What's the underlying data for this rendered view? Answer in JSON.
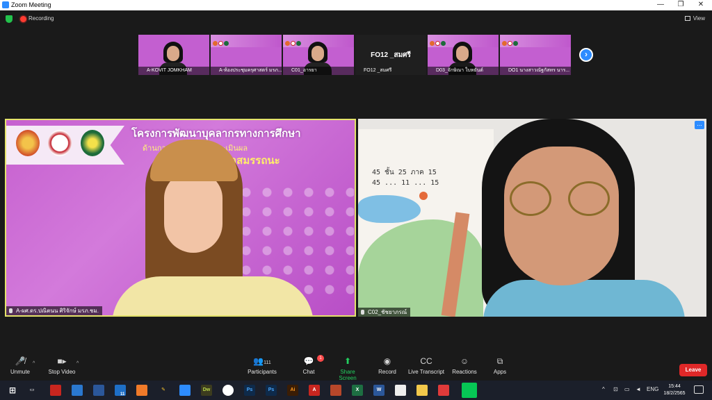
{
  "window": {
    "title": "Zoom Meeting",
    "minimize": "—",
    "restore": "❐",
    "close": "✕"
  },
  "status": {
    "recording_label": "Recording",
    "view_label": "View"
  },
  "thumbnails": [
    {
      "name": "A-KOVIT JOMKHAM",
      "kind": "video-man"
    },
    {
      "name": "A-ห้องประชุมครุศาสตร์ มรภ....",
      "kind": "slide"
    },
    {
      "name": "C01_อารยา",
      "kind": "video-woman"
    },
    {
      "name": "FO12 _สมศรี",
      "kind": "name-only",
      "big_label": "FO12 _สมศรี"
    },
    {
      "name": "D03_จักษิณา ใบหยันต์",
      "kind": "video-woman"
    },
    {
      "name": "DO1 นางสาวณัฐกัสทร  นาร...",
      "kind": "slide"
    }
  ],
  "main_left": {
    "name": "A-ผศ.ดร.ปณิตนน ศิริจักษ์ มรภ.ชม.",
    "slide_title": "โครงการพัฒนาบุคลากรทางการศึกษา",
    "slide_subtitle": "ด้านการ...และการวัดประเมินผล",
    "slide_subtitle2": "...นาสมรรถนะ"
  },
  "main_right": {
    "name": "C02_ชัชยาภรณ์",
    "paper_lines": [
      "45   ชั้น    25 ภาค 15",
      "45   ...    11  ...  15"
    ],
    "more_label": "..."
  },
  "toolbar": {
    "unmute": "Unmute",
    "stop_video": "Stop Video",
    "participants": "Participants",
    "participants_count": "111",
    "chat": "Chat",
    "chat_badge": "1",
    "share_screen": "Share Screen",
    "record": "Record",
    "live_transcript": "Live Transcript",
    "reactions": "Reactions",
    "apps": "Apps",
    "leave": "Leave"
  },
  "taskbar": {
    "language": "ENG",
    "time": "15:44",
    "date": "18/2/2565",
    "mail_badge": "11",
    "apps": [
      "Ps",
      "Ps",
      "Ai",
      "A",
      "X",
      "W",
      "Dw"
    ]
  },
  "colors": {
    "accent": "#2d8cff",
    "leave": "#e02828",
    "active_speaker": "#e4e36a",
    "share_green": "#23d160"
  }
}
